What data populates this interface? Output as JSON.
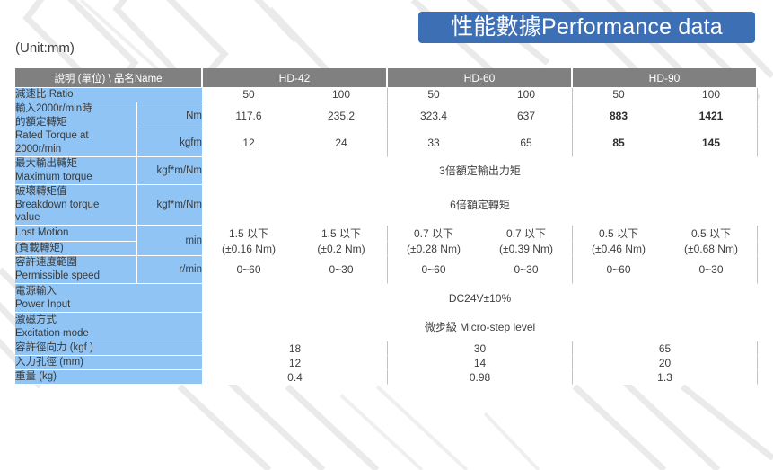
{
  "banner": {
    "title": "性能數據Performance data",
    "color": "#3D6FB5"
  },
  "unit_note": "(Unit:mm)",
  "table": {
    "header": {
      "first_col": "說明 (單位) \\ 品名Name",
      "models": [
        "HD-42",
        "HD-60",
        "HD-90"
      ]
    },
    "rows": {
      "ratio": {
        "label": "減速比 Ratio",
        "values": [
          "50",
          "100",
          "50",
          "100",
          "50",
          "100"
        ]
      },
      "rated_torque": {
        "label": "輸入2000r/min時\n的額定轉矩\nRated Torque at\n2000r/min",
        "label_l1": "輸入2000r/min時",
        "label_l2": "的額定轉矩",
        "label_l3": "Rated Torque at",
        "label_l4": "2000r/min",
        "unit_nm": "Nm",
        "unit_kgfm": "kgfm",
        "values_nm": [
          "117.6",
          "235.2",
          "323.4",
          "637",
          "883",
          "1421"
        ],
        "values_kgfm": [
          "12",
          "24",
          "33",
          "65",
          "85",
          "145"
        ]
      },
      "max_torque": {
        "label_l1": "最大輸出轉矩",
        "label_l2": "Maximum torque",
        "unit": "kgf*m/Nm",
        "value": "3倍額定輸出力矩"
      },
      "breakdown_torque": {
        "label_l1": "破壞轉矩值",
        "label_l2": "Breakdown torque",
        "label_l3": "value",
        "unit": "kgf*m/Nm",
        "value": "6倍額定轉矩"
      },
      "lost_motion": {
        "label": "Lost Motion",
        "label2": "(負載轉矩)",
        "unit": "min",
        "values": [
          "1.5 以下",
          "1.5 以下",
          "0.7 以下",
          "0.7 以下",
          "0.5 以下",
          "0.5 以下"
        ],
        "values2": [
          "(±0.16 Nm)",
          "(±0.2 Nm)",
          "(±0.28 Nm)",
          "(±0.39 Nm)",
          "(±0.46 Nm)",
          "(±0.68 Nm)"
        ]
      },
      "permissible_speed": {
        "label_l1": "容許速度範圍",
        "label_l2": "Permissible speed",
        "unit": "r/min",
        "values": [
          "0~60",
          "0~30",
          "0~60",
          "0~30",
          "0~60",
          "0~30"
        ]
      },
      "power_input": {
        "label_l1": "電源輸入",
        "label_l2": "Power Input",
        "value": "DC24V±10%"
      },
      "excitation_mode": {
        "label_l1": "激磁方式",
        "label_l2": "Excitation mode",
        "value": "微步級  Micro-step level"
      },
      "radial_force": {
        "label": "容許徑向力 (kgf )",
        "values": [
          "18",
          "30",
          "65"
        ]
      },
      "input_bore": {
        "label": "入力孔徑 (mm)",
        "values": [
          "12",
          "14",
          "20"
        ]
      },
      "weight": {
        "label": "重量 (kg)",
        "values": [
          "0.4",
          "0.98",
          "1.3"
        ]
      }
    }
  },
  "colors": {
    "header_gray": "#808080",
    "label_blue": "#8FC4F5",
    "banner_blue": "#3D6FB5",
    "grid_blue": "#CFE4F8"
  }
}
